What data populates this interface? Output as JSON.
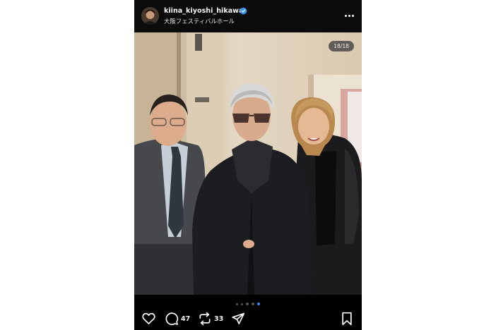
{
  "post": {
    "username": "kiina_kiyoshi_hikawa",
    "location": "大阪フェスティバルホール",
    "verified": true,
    "more_icon": "more-horizontal-icon"
  },
  "carousel": {
    "counter": "18/18",
    "current": 18,
    "total": 18
  },
  "actions": {
    "like_icon": "heart-icon",
    "comment_icon": "comment-icon",
    "comments": "47",
    "repost_icon": "repost-icon",
    "reposts": "33",
    "share_icon": "send-icon",
    "save_icon": "bookmark-icon"
  },
  "colors": {
    "background": "#000000",
    "text": "#ffffff",
    "verified": "#3797f0",
    "active_dot": "#3b82f6"
  }
}
